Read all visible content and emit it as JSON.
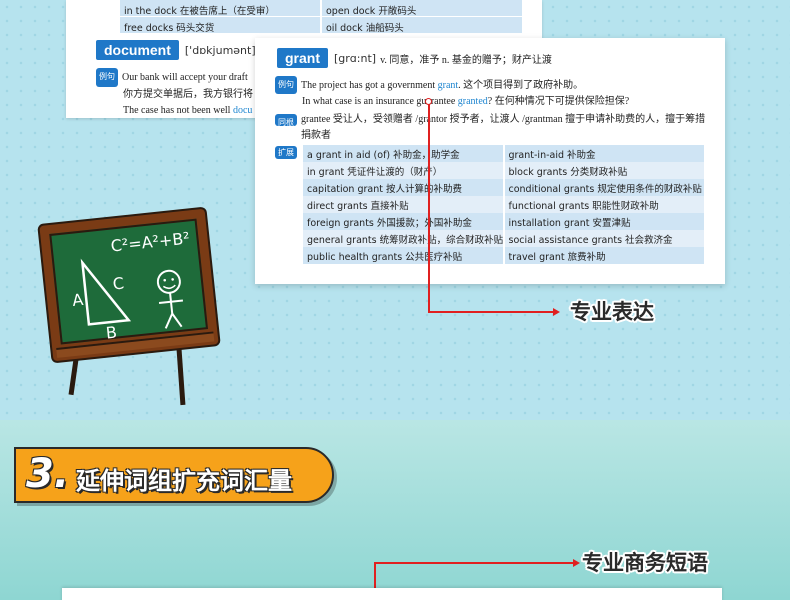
{
  "top_table": {
    "rows": [
      [
        "in the dock 在被告席上（在受审）",
        "open dock 开敞码头"
      ],
      [
        "free docks 码头交货",
        "oil dock 油船码头"
      ]
    ]
  },
  "document_entry": {
    "headword": "document",
    "pron": "['dɒkjumənt]",
    "example_badge": "例句",
    "line1": "Our bank will accept your draft",
    "line2": "你方提交单据后，我方银行将",
    "line3_pre": "The case has not been well ",
    "line3_hl": "docu"
  },
  "grant_entry": {
    "headword": "grant",
    "pron": "[grɑ:nt]",
    "definition": "v. 同意，准予 n. 基金的赠予；财产让渡",
    "example_badge": "例句",
    "ex1_pre": "The project has got a government ",
    "ex1_hl": "grant",
    "ex1_post": ". 这个项目得到了政府补助。",
    "ex2_pre": "In what case is an insurance guarantee ",
    "ex2_hl": "granted",
    "ex2_post": "? 在何种情况下可提供保险担保?",
    "related_badge": "同根",
    "related_text": "grantee 受让人，受领赠者 /grantor 授予者，让渡人 /grantman 擅于申请补助费的人，擅于筹措捐款者",
    "expand_badge": "扩展",
    "expand_rows": [
      [
        "a grant in aid (of) 补助金，助学金",
        "grant-in-aid 补助金"
      ],
      [
        "in grant 凭证件让渡的（财产）",
        "block grants 分类财政补贴"
      ],
      [
        "capitation grant 按人计算的补助费",
        "conditional grants 规定使用条件的财政补贴"
      ],
      [
        "direct grants 直接补贴",
        "functional grants 职能性财政补助"
      ],
      [
        "foreign grants 外国援款；外国补助金",
        "installation grant 安置津贴"
      ],
      [
        "general grants 统筹财政补贴，综合财政补贴",
        "social assistance grants 社会救济金"
      ],
      [
        "public health grants 公共医疗补贴",
        "travel grant 旅费补助"
      ]
    ]
  },
  "callouts": {
    "professional_expression": "专业表达",
    "business_phrases": "专业商务短语"
  },
  "section": {
    "number": "3.",
    "title": "延伸词组扩充词汇量"
  },
  "chalkboard": {
    "formula": "C²=A²+B²",
    "label_a": "A",
    "label_b": "B",
    "label_c": "C"
  },
  "colors": {
    "accent_blue": "#1f78c8",
    "highlight_blue": "#1f86d0",
    "connector_red": "#e02020",
    "banner_orange": "#f6a21a",
    "board_green": "#1e6b3a"
  }
}
